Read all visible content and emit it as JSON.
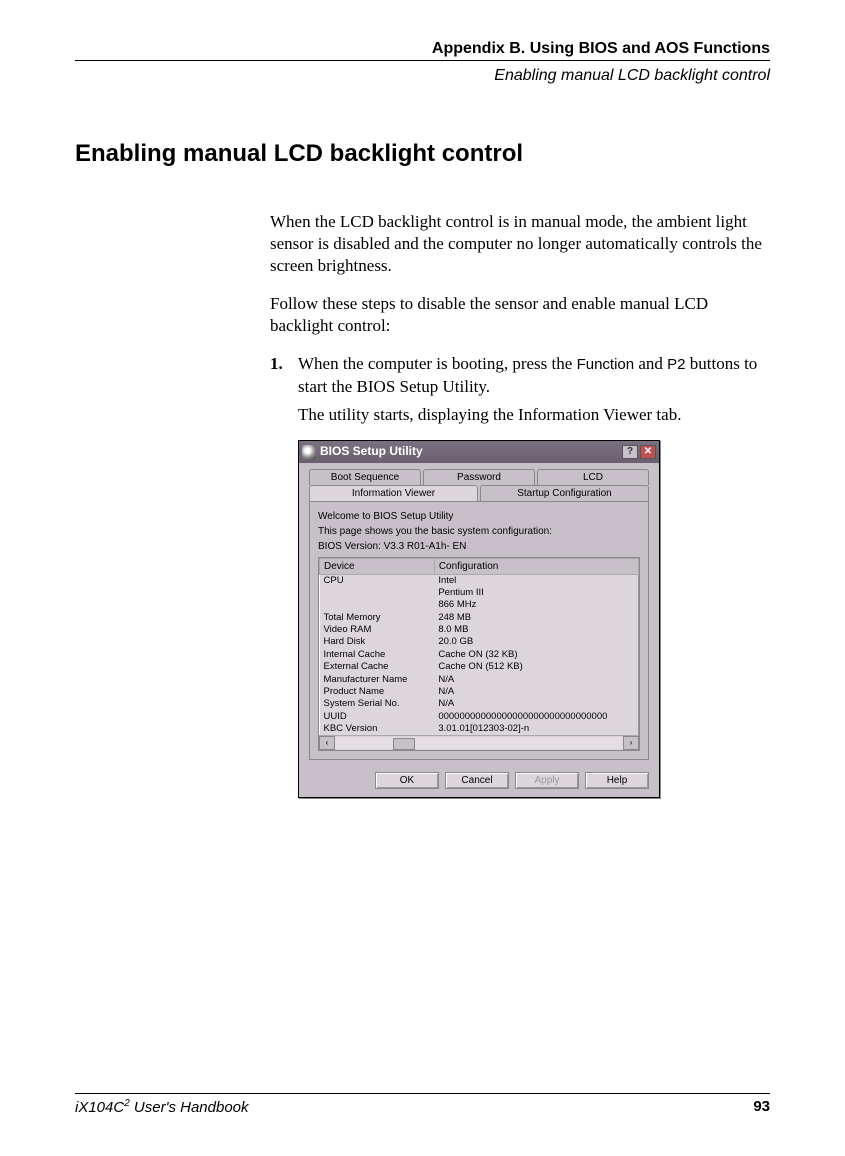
{
  "header": {
    "title": "Appendix B. Using BIOS and AOS Functions",
    "subtitle": "Enabling manual LCD backlight control"
  },
  "section_title": "Enabling manual LCD backlight control",
  "para1": "When the LCD backlight control is in manual mode, the ambient light sensor is disabled and the computer no longer automatically controls the screen brightness.",
  "para2": "Follow these steps to disable the sensor and enable manual LCD backlight control:",
  "step1": {
    "num": "1.",
    "pre": "When the computer is booting, press the ",
    "kw1": "Function",
    "mid": " and ",
    "kw2": "P2",
    "post": " buttons to start the BIOS Setup Utility.",
    "follow": "The utility starts, displaying the Information Viewer tab."
  },
  "bios": {
    "title": "BIOS Setup Utility",
    "help_glyph": "?",
    "close_glyph": "✕",
    "tabs_row1": [
      "Boot Sequence",
      "Password",
      "LCD"
    ],
    "tabs_row2": [
      "Information Viewer",
      "Startup Configuration"
    ],
    "active_tab_index_row2": 0,
    "welcome1": "Welcome to BIOS Setup Utility",
    "welcome2": "This page shows you the basic system configuration:",
    "welcome3": "BIOS Version: V3.3 R01-A1h- EN",
    "columns": [
      "Device",
      "Configuration"
    ],
    "rows": [
      [
        "CPU",
        "Intel"
      ],
      [
        "",
        "Pentium III"
      ],
      [
        "",
        "866 MHz"
      ],
      [
        "Total Memory",
        "248 MB"
      ],
      [
        "Video RAM",
        "8.0 MB"
      ],
      [
        "Hard Disk",
        "20.0 GB"
      ],
      [
        "Internal Cache",
        "Cache ON (32 KB)"
      ],
      [
        "External Cache",
        "Cache ON (512 KB)"
      ],
      [
        "Manufacturer Name",
        "N/A"
      ],
      [
        "Product Name",
        "N/A"
      ],
      [
        "System Serial No.",
        "N/A"
      ],
      [
        "UUID",
        "00000000000000000000000000000000"
      ],
      [
        "KBC Version",
        "3.01.01[012303-02]-n"
      ]
    ],
    "scroll_left": "‹",
    "scroll_right": "›",
    "buttons": {
      "ok": "OK",
      "cancel": "Cancel",
      "apply": "Apply",
      "help": "Help"
    }
  },
  "footer": {
    "book_pre": "iX104C",
    "book_sup": "2",
    "book_post": " User's Handbook",
    "page": "93"
  }
}
